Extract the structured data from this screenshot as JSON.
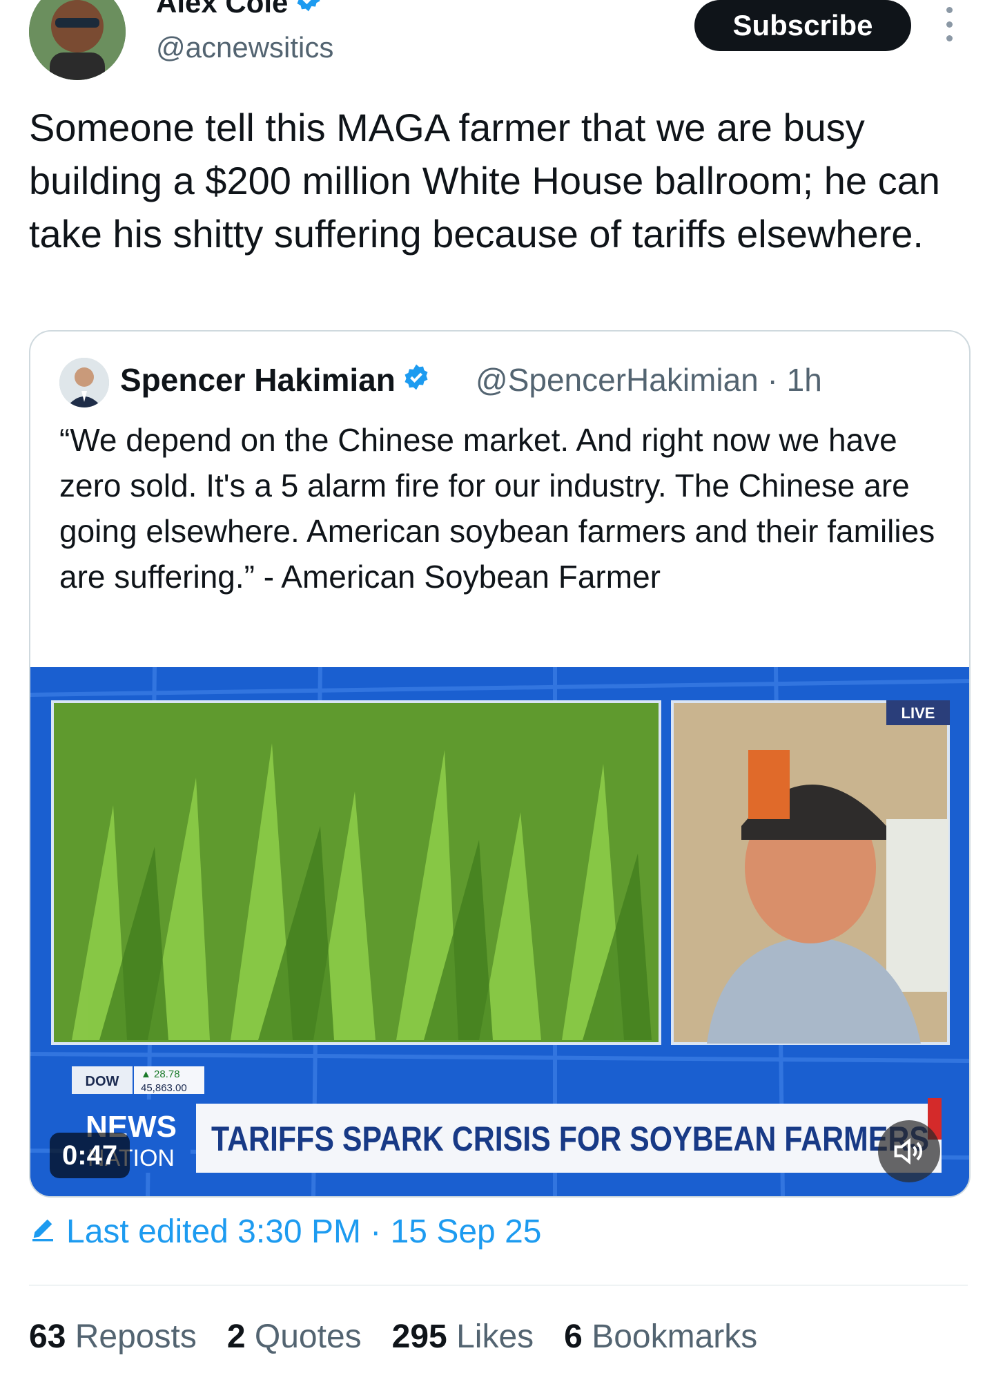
{
  "author": {
    "display_name": "Alex Cole",
    "handle": "@acnewsitics"
  },
  "header": {
    "subscribe_label": "Subscribe"
  },
  "tweet": {
    "text": "Someone tell this MAGA farmer that we are busy building a $200 million White House ballroom; he can take his shitty suffering because of tariffs elsewhere."
  },
  "quote": {
    "display_name": "Spencer Hakimian",
    "handle": "@SpencerHakimian",
    "time": "1h",
    "text": "“We depend on the Chinese market. And right now we have zero sold. It's a 5 alarm fire for our industry. The Chinese are going elsewhere. American soybean farmers and their families are suffering.” - American Soybean Farmer",
    "video": {
      "duration": "0:47",
      "live_label": "LIVE",
      "ticker_label": "DOW",
      "ticker_change": "▲ 28.78",
      "ticker_value": "45,863.00",
      "network_line1": "NEWS",
      "network_line2": "NATION",
      "headline": "TARIFFS SPARK CRISIS FOR SOYBEAN FARMERS"
    }
  },
  "edited": {
    "text": "Last edited 3:30 PM · 15 Sep 25"
  },
  "stats": [
    {
      "count": "63",
      "label": "Reposts"
    },
    {
      "count": "2",
      "label": "Quotes"
    },
    {
      "count": "295",
      "label": "Likes"
    },
    {
      "count": "6",
      "label": "Bookmarks"
    }
  ],
  "colors": {
    "accent": "#1d9bf0",
    "text": "#0f1419",
    "muted": "#536471",
    "video_bg": "#1a5fd0"
  }
}
